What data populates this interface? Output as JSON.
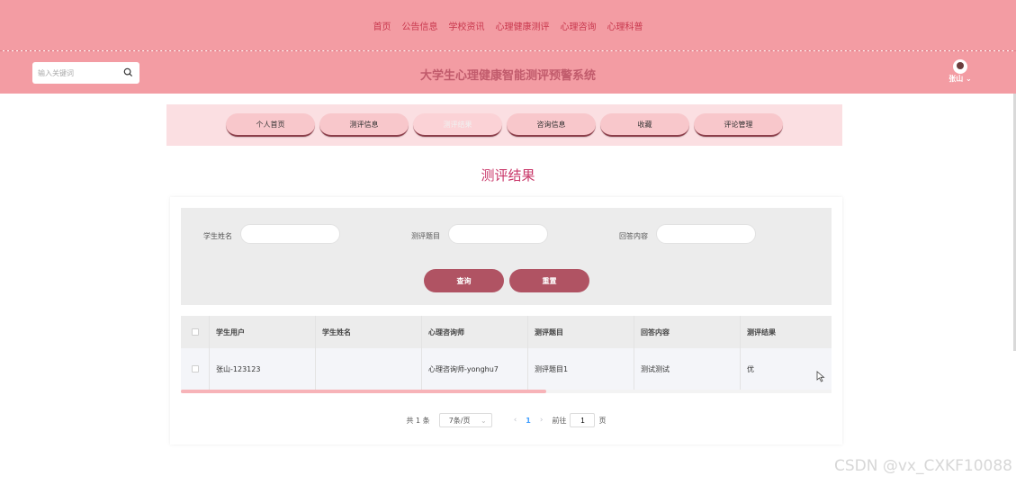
{
  "top_nav": [
    "首页",
    "公告信息",
    "学校资讯",
    "心理健康测评",
    "心理咨询",
    "心理科普"
  ],
  "header": {
    "search_placeholder": "输入关键词",
    "site_title": "大学生心理健康智能测评预警系统",
    "user_name": "张山"
  },
  "tabs": [
    {
      "label": "个人首页",
      "active": false
    },
    {
      "label": "测评信息",
      "active": false
    },
    {
      "label": "测评结果",
      "active": true
    },
    {
      "label": "咨询信息",
      "active": false
    },
    {
      "label": "收藏",
      "active": false
    },
    {
      "label": "评论管理",
      "active": false
    }
  ],
  "page_title": "测评结果",
  "filters": {
    "student_name_label": "学生姓名",
    "question_label": "测评题目",
    "answer_label": "回答内容",
    "query_button": "查询",
    "reset_button": "重置"
  },
  "table": {
    "headers": [
      "学生用户",
      "学生姓名",
      "心理咨询师",
      "测评题目",
      "回答内容",
      "测评结果"
    ],
    "rows": [
      [
        "张山-123123",
        "",
        "心理咨询师-yonghu7",
        "测评题目1",
        "测试测试",
        "优"
      ]
    ]
  },
  "pagination": {
    "total": "共 1 条",
    "page_size": "7条/页",
    "prev": "‹",
    "current_page": "1",
    "next": "›",
    "goto_label": "前往",
    "goto_value": "1",
    "page_suffix": "页"
  },
  "watermark": "CSDN @vx_CXKF10088",
  "colors": {
    "primary": "#f39ca3",
    "accent": "#b05363",
    "title": "#c9386a",
    "link": "#409eff"
  }
}
